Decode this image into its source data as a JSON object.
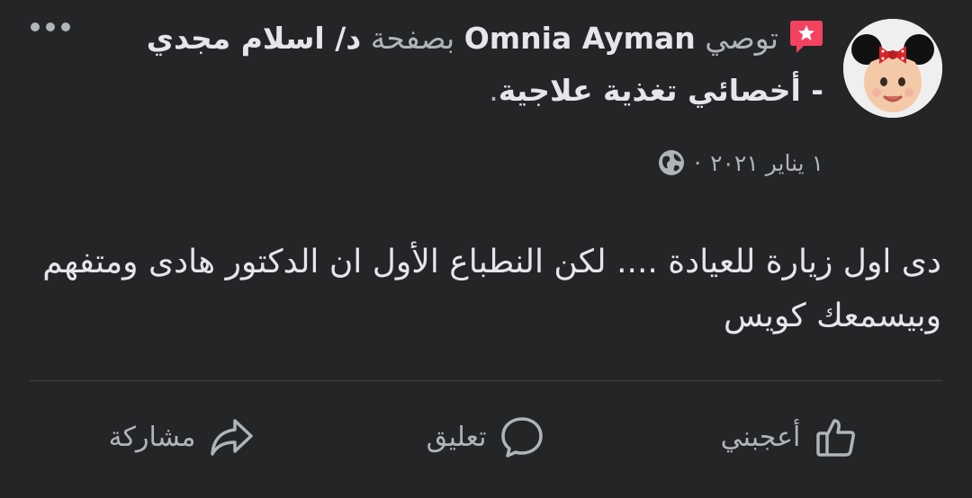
{
  "post": {
    "recommender": "Omnia Ayman",
    "verb": "توصي",
    "connector": "بصفحة",
    "page_name": "د/ اسلام مجدي - أخصائي تغذية علاجية",
    "end_punct": ".",
    "date": "١ يناير ٢٠٢١",
    "dot_sep": "·",
    "privacy_icon": "globe-icon",
    "body": "دى اول زيارة للعيادة .... لكن النطباع الأول ان الدكتور هادى ومتفهم وبيسمعك كويس"
  },
  "actions": {
    "like": "أعجبني",
    "comment": "تعليق",
    "share": "مشاركة"
  },
  "colors": {
    "background": "#242526",
    "primary_text": "#e4e6eb",
    "secondary_text": "#b0b3b8",
    "recommend_icon": "#f3425f"
  }
}
